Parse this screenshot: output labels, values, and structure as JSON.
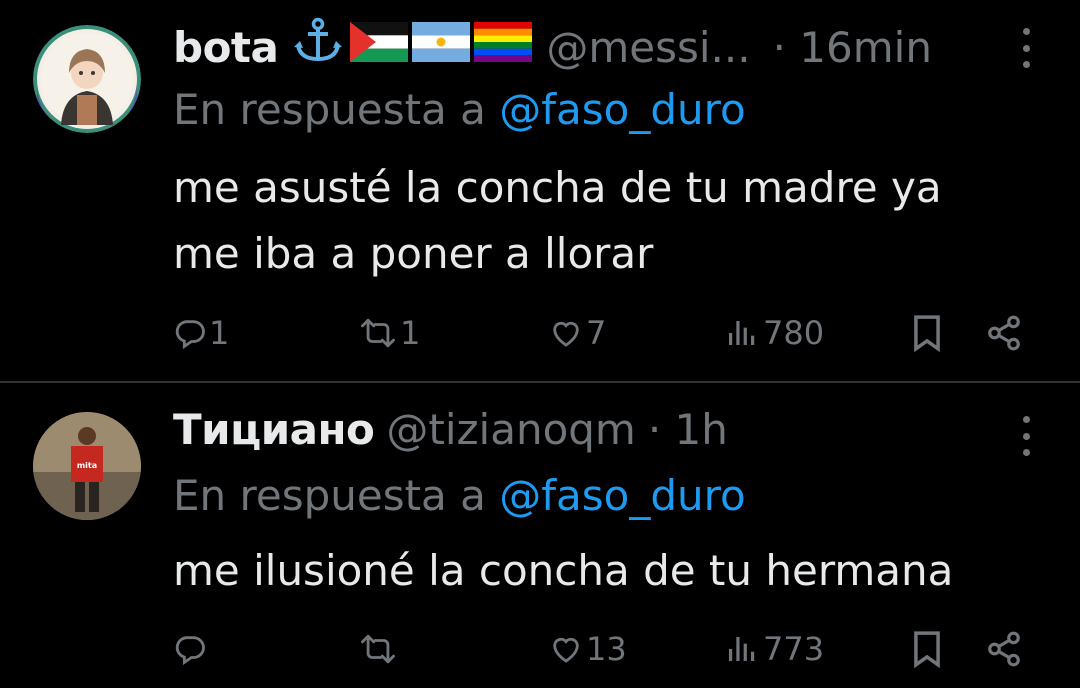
{
  "tweets": [
    {
      "name": "bota",
      "handle": "@messi...",
      "time": "· 16min",
      "reply_prefix": "En respuesta a",
      "reply_mention": "@faso_duro",
      "text_line1": "me asusté la concha de tu madre ya",
      "text_line2": "me iba a poner a llorar",
      "replies": "1",
      "retweets": "1",
      "likes": "7",
      "views": "780",
      "flags": [
        "anchor",
        "palestine-flag",
        "argentina-flag",
        "rainbow-flag"
      ]
    },
    {
      "name": "Тициано",
      "handle": "@tizianoqm",
      "time": "· 1h",
      "reply_prefix": "En respuesta a",
      "reply_mention": "@faso_duro",
      "text_line1": "me ilusioné la concha de tu hermana",
      "replies": "",
      "retweets": "",
      "likes": "13",
      "views": "773"
    }
  ],
  "colors": {
    "background": "#000000",
    "text": "#e7e9ea",
    "muted": "#71767b",
    "link": "#1d9bf0",
    "divider": "#2f3336"
  }
}
